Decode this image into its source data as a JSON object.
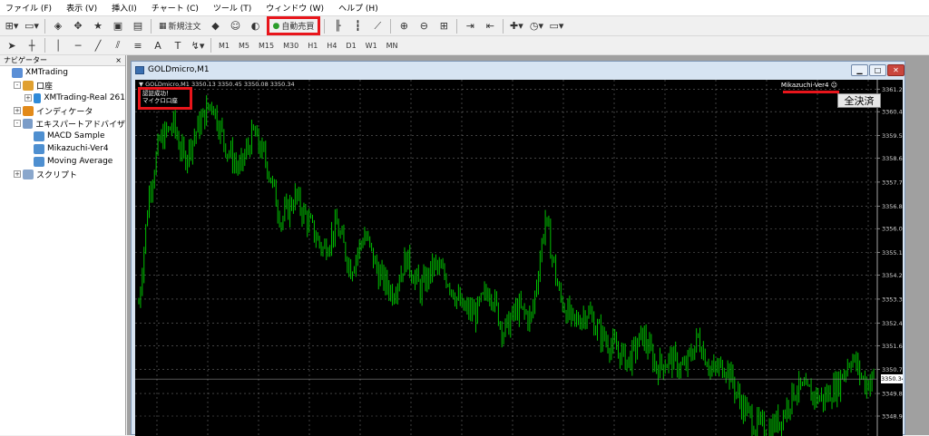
{
  "menu": [
    "ファイル (F)",
    "表示 (V)",
    "挿入(I)",
    "チャート (C)",
    "ツール (T)",
    "ウィンドウ (W)",
    "ヘルプ (H)"
  ],
  "toolbar": {
    "new_order_label": "新規注文",
    "auto_trade_label": "自動売買",
    "timeframes": [
      "M1",
      "M5",
      "M15",
      "M30",
      "H1",
      "H4",
      "D1",
      "W1",
      "MN"
    ],
    "text_tool_label": "A"
  },
  "navigator": {
    "title": "ナビゲーター",
    "close": "×",
    "items": [
      {
        "label": "XMTrading",
        "indent": 0,
        "toggle": "",
        "icon": "xm-logo-icon"
      },
      {
        "label": "口座",
        "indent": 1,
        "toggle": "-",
        "icon": "accounts-icon"
      },
      {
        "label": "XMTrading-Real 261",
        "indent": 2,
        "toggle": "+",
        "icon": "account-icon"
      },
      {
        "label": "インディケータ",
        "indent": 1,
        "toggle": "+",
        "icon": "indicators-icon"
      },
      {
        "label": "エキスパートアドバイザ",
        "indent": 1,
        "toggle": "-",
        "icon": "experts-icon"
      },
      {
        "label": "MACD Sample",
        "indent": 2,
        "toggle": "",
        "icon": "ea-icon"
      },
      {
        "label": "Mikazuchi-Ver4",
        "indent": 2,
        "toggle": "",
        "icon": "ea-icon"
      },
      {
        "label": "Moving Average",
        "indent": 2,
        "toggle": "",
        "icon": "ea-icon"
      },
      {
        "label": "スクリプト",
        "indent": 1,
        "toggle": "+",
        "icon": "scripts-icon"
      }
    ]
  },
  "chart_window": {
    "title": "GOLDmicro,M1",
    "status_line": "▼ GOLDmicro,M1  3350.13 3350.45 3350.08 3350.34",
    "status_lines": [
      "認証成功！",
      "マイクロ口座"
    ],
    "ea_label": "Mikazuchi-Ver4 ☺",
    "close_all_label": "全決済",
    "current_price": "3350.34"
  },
  "chart_data": {
    "type": "bar",
    "symbol": "GOLDmicro",
    "timeframe": "M1",
    "ylim": [
      3348.2,
      3361.6
    ],
    "y_ticks": [
      "3361.25",
      "3360.40",
      "3359.50",
      "3358.65",
      "3357.75",
      "3356.85",
      "3356.00",
      "3355.10",
      "3354.25",
      "3353.35",
      "3352.45",
      "3351.60",
      "3350.70",
      "3349.80",
      "3348.95"
    ],
    "last_price": 3350.34,
    "waypoints": [
      [
        0,
        3353.2
      ],
      [
        6,
        3357.4
      ],
      [
        12,
        3359.3
      ],
      [
        20,
        3359.9
      ],
      [
        26,
        3358.6
      ],
      [
        34,
        3359.8
      ],
      [
        42,
        3360.8
      ],
      [
        50,
        3359.1
      ],
      [
        58,
        3358.2
      ],
      [
        66,
        3359.6
      ],
      [
        74,
        3358.4
      ],
      [
        82,
        3356.3
      ],
      [
        90,
        3357.2
      ],
      [
        98,
        3356.2
      ],
      [
        106,
        3355.2
      ],
      [
        114,
        3356.1
      ],
      [
        122,
        3354.5
      ],
      [
        130,
        3355.8
      ],
      [
        138,
        3354.3
      ],
      [
        146,
        3353.6
      ],
      [
        154,
        3354.9
      ],
      [
        162,
        3353.7
      ],
      [
        170,
        3354.6
      ],
      [
        178,
        3354.1
      ],
      [
        186,
        3353.0
      ],
      [
        194,
        3352.8
      ],
      [
        202,
        3353.8
      ],
      [
        210,
        3352.1
      ],
      [
        218,
        3353.0
      ],
      [
        226,
        3352.6
      ],
      [
        234,
        3356.4
      ],
      [
        242,
        3353.5
      ],
      [
        250,
        3352.4
      ],
      [
        258,
        3352.9
      ],
      [
        266,
        3352.0
      ],
      [
        274,
        3351.5
      ],
      [
        282,
        3351.0
      ],
      [
        290,
        3352.0
      ],
      [
        298,
        3350.8
      ],
      [
        306,
        3351.1
      ],
      [
        314,
        3350.7
      ],
      [
        322,
        3351.9
      ],
      [
        330,
        3350.6
      ],
      [
        338,
        3350.9
      ],
      [
        346,
        3349.5
      ],
      [
        354,
        3348.7
      ],
      [
        362,
        3348.4
      ],
      [
        370,
        3348.9
      ],
      [
        378,
        3350.0
      ],
      [
        386,
        3349.8
      ],
      [
        394,
        3349.6
      ],
      [
        402,
        3350.1
      ],
      [
        410,
        3351.2
      ],
      [
        418,
        3350.2
      ],
      [
        423,
        3350.34
      ]
    ]
  }
}
